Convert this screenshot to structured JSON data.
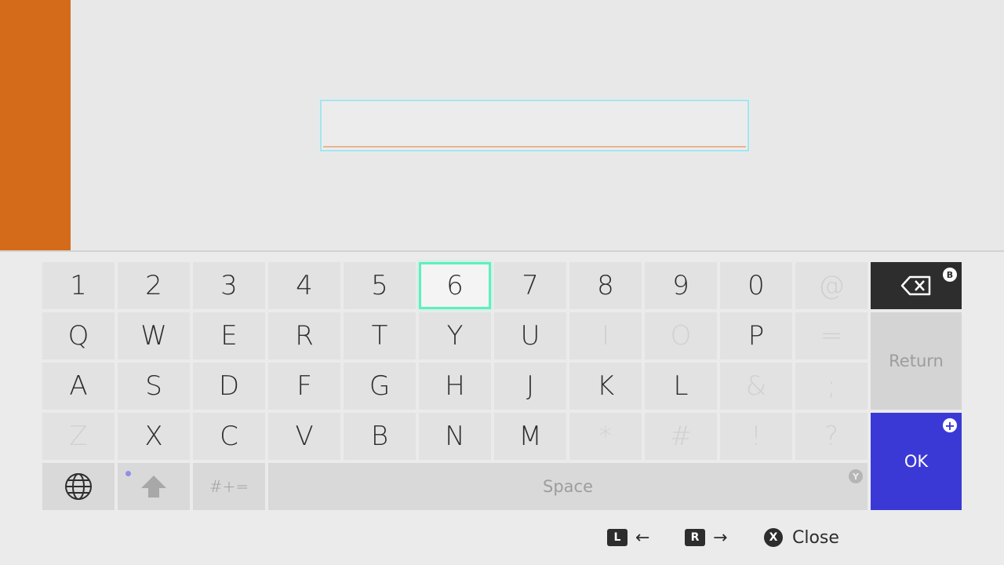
{
  "colors": {
    "accent_orange": "#d36b1a",
    "ok_blue": "#3b39d6",
    "selection_green": "#5ef0bf",
    "backspace_dark": "#2d2d2d"
  },
  "text_input": {
    "value": ""
  },
  "keyboard": {
    "rows": [
      [
        {
          "label": "1",
          "enabled": true
        },
        {
          "label": "2",
          "enabled": true
        },
        {
          "label": "3",
          "enabled": true
        },
        {
          "label": "4",
          "enabled": true
        },
        {
          "label": "5",
          "enabled": true
        },
        {
          "label": "6",
          "enabled": true,
          "selected": true
        },
        {
          "label": "7",
          "enabled": true
        },
        {
          "label": "8",
          "enabled": true
        },
        {
          "label": "9",
          "enabled": true
        },
        {
          "label": "0",
          "enabled": true
        },
        {
          "label": "@",
          "enabled": false
        }
      ],
      [
        {
          "label": "Q",
          "enabled": true
        },
        {
          "label": "W",
          "enabled": true
        },
        {
          "label": "E",
          "enabled": true
        },
        {
          "label": "R",
          "enabled": true
        },
        {
          "label": "T",
          "enabled": true
        },
        {
          "label": "Y",
          "enabled": true
        },
        {
          "label": "U",
          "enabled": true
        },
        {
          "label": "I",
          "enabled": false
        },
        {
          "label": "O",
          "enabled": false
        },
        {
          "label": "P",
          "enabled": true
        },
        {
          "label": "=",
          "enabled": false
        }
      ],
      [
        {
          "label": "A",
          "enabled": true
        },
        {
          "label": "S",
          "enabled": true
        },
        {
          "label": "D",
          "enabled": true
        },
        {
          "label": "F",
          "enabled": true
        },
        {
          "label": "G",
          "enabled": true
        },
        {
          "label": "H",
          "enabled": true
        },
        {
          "label": "J",
          "enabled": true
        },
        {
          "label": "K",
          "enabled": true
        },
        {
          "label": "L",
          "enabled": true
        },
        {
          "label": "&",
          "enabled": false
        },
        {
          "label": ";",
          "enabled": false
        }
      ],
      [
        {
          "label": "Z",
          "enabled": false
        },
        {
          "label": "X",
          "enabled": true
        },
        {
          "label": "C",
          "enabled": true
        },
        {
          "label": "V",
          "enabled": true
        },
        {
          "label": "B",
          "enabled": true
        },
        {
          "label": "N",
          "enabled": true
        },
        {
          "label": "M",
          "enabled": true
        },
        {
          "label": "*",
          "enabled": false
        },
        {
          "label": "#",
          "enabled": false
        },
        {
          "label": "!",
          "enabled": false
        },
        {
          "label": "?",
          "enabled": false
        }
      ]
    ],
    "symbols_label": "#+=",
    "space_label": "Space",
    "space_badge": "Y",
    "return_label": "Return",
    "ok_label": "OK",
    "backspace_badge": "B",
    "ok_badge": "+",
    "globe_icon": "globe-icon",
    "shift_icon": "shift-arrow-icon",
    "backspace_icon": "backspace-icon"
  },
  "hints": {
    "left_button": "L",
    "left_arrow": "←",
    "right_button": "R",
    "right_arrow": "→",
    "close_button": "X",
    "close_label": "Close"
  }
}
